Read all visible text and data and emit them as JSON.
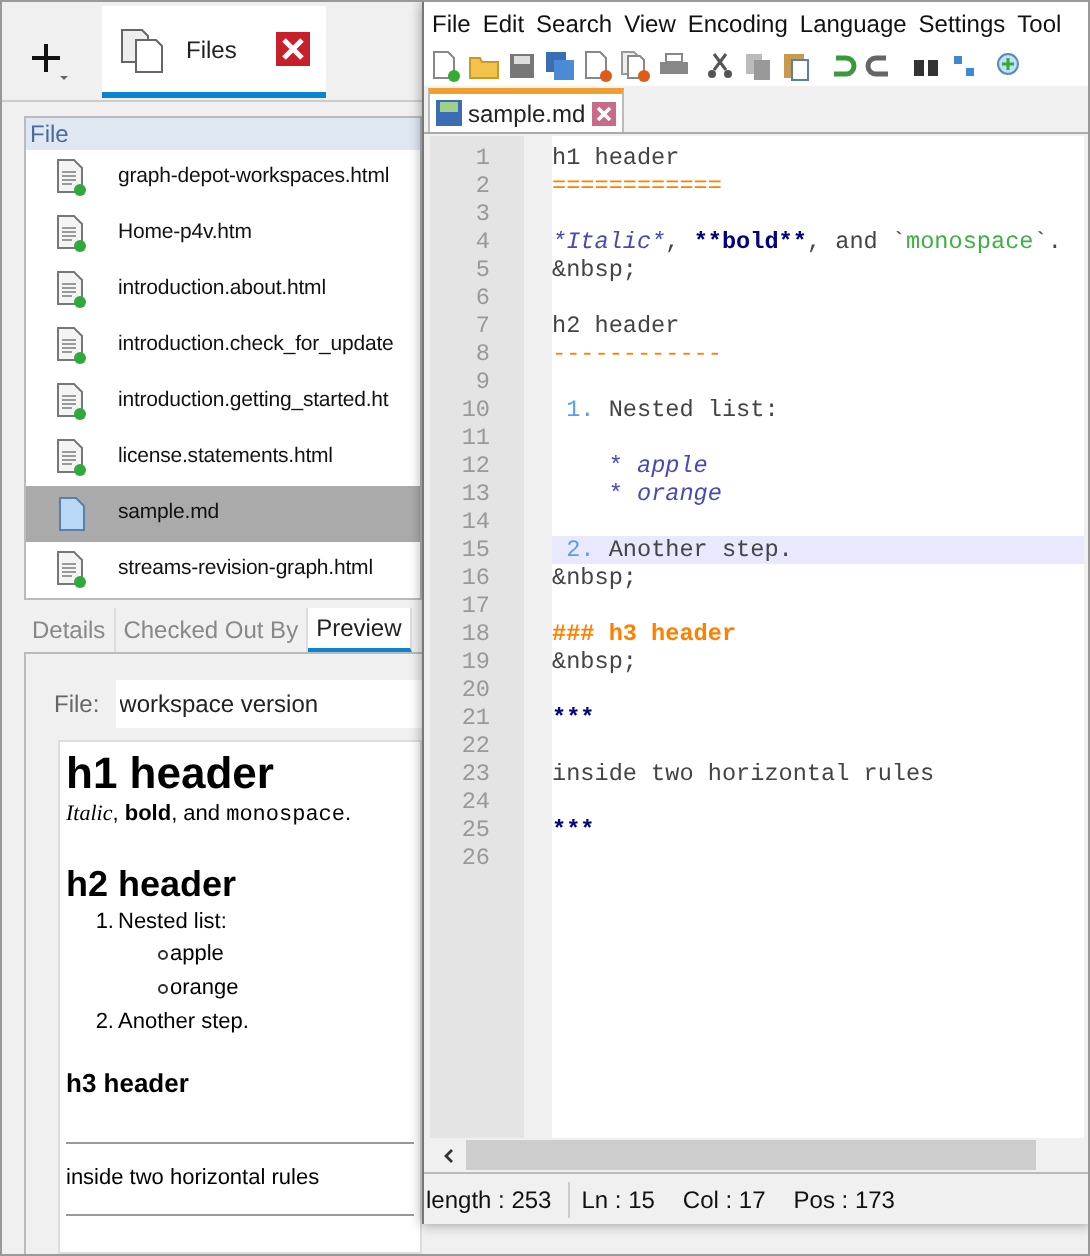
{
  "workspace_panel": {
    "tab": {
      "label": "Files",
      "selected": true
    },
    "file_list": {
      "column": "File",
      "rows": [
        {
          "name": "graph-depot-workspaces.html",
          "kind": "html",
          "selected": false
        },
        {
          "name": "Home-p4v.htm",
          "kind": "html",
          "selected": false
        },
        {
          "name": "introduction.about.html",
          "kind": "html",
          "selected": false
        },
        {
          "name": "introduction.check_for_update",
          "kind": "html",
          "selected": false
        },
        {
          "name": "introduction.getting_started.ht",
          "kind": "html",
          "selected": false
        },
        {
          "name": "license.statements.html",
          "kind": "html",
          "selected": false
        },
        {
          "name": "sample.md",
          "kind": "md",
          "selected": true
        },
        {
          "name": "streams-revision-graph.html",
          "kind": "html",
          "selected": false
        }
      ]
    },
    "detail_tabs": [
      {
        "label": "Details",
        "selected": false
      },
      {
        "label": "Checked Out By",
        "selected": false
      },
      {
        "label": "Preview",
        "selected": true
      }
    ],
    "file_field": {
      "label": "File:",
      "value": "workspace version"
    },
    "preview": [
      {
        "kind": "h1",
        "text": "h1 header"
      },
      {
        "kind": "para",
        "segments": [
          {
            "kind": "italic",
            "text": "Italic"
          },
          {
            "kind": "plain",
            "text": ", "
          },
          {
            "kind": "bold",
            "text": "bold"
          },
          {
            "kind": "plain",
            "text": ", and "
          },
          {
            "kind": "code",
            "text": "monospace"
          },
          {
            "kind": "plain",
            "text": "."
          }
        ]
      },
      {
        "kind": "h2",
        "text": "h2 header"
      },
      {
        "kind": "ol",
        "number": "1.",
        "text": "Nested list:",
        "children": [
          {
            "text": "apple"
          },
          {
            "text": "orange"
          }
        ]
      },
      {
        "kind": "ol",
        "number": "2.",
        "text": "Another step."
      },
      {
        "kind": "h3",
        "text": "h3 header"
      },
      {
        "kind": "hr"
      },
      {
        "kind": "text",
        "text": "inside two horizontal rules"
      },
      {
        "kind": "hr"
      }
    ]
  },
  "editor": {
    "menu": [
      "File",
      "Edit",
      "Search",
      "View",
      "Encoding",
      "Language",
      "Settings",
      "Tool"
    ],
    "tab": {
      "label": "sample.md",
      "selected": true
    },
    "lines": [
      {
        "number": "1",
        "current": false,
        "segments": [
          {
            "kind": "plain",
            "text": "h1 header"
          }
        ]
      },
      {
        "number": "2",
        "current": false,
        "segments": [
          {
            "kind": "heading",
            "text": "============"
          }
        ]
      },
      {
        "number": "3",
        "current": false
      },
      {
        "number": "4",
        "current": false,
        "segments": [
          {
            "kind": "italic",
            "text": "*Italic*"
          },
          {
            "kind": "plain",
            "text": ", "
          },
          {
            "kind": "bold",
            "text": "**bold**"
          },
          {
            "kind": "plain",
            "text": ", and `"
          },
          {
            "kind": "code",
            "text": "monospace"
          },
          {
            "kind": "plain",
            "text": "`."
          }
        ]
      },
      {
        "number": "5",
        "current": false,
        "segments": [
          {
            "kind": "plain",
            "text": "&nbsp;"
          }
        ]
      },
      {
        "number": "6",
        "current": false
      },
      {
        "number": "7",
        "current": false,
        "segments": [
          {
            "kind": "plain",
            "text": "h2 header"
          }
        ]
      },
      {
        "number": "8",
        "current": false,
        "segments": [
          {
            "kind": "heading",
            "text": "------------"
          }
        ]
      },
      {
        "number": "9",
        "current": false
      },
      {
        "number": "10",
        "current": false,
        "segments": [
          {
            "kind": "number",
            "text": " 1. "
          },
          {
            "kind": "plain",
            "text": "Nested list:"
          }
        ]
      },
      {
        "number": "11",
        "current": false
      },
      {
        "number": "12",
        "current": false,
        "segments": [
          {
            "kind": "bullet",
            "text": "    * "
          },
          {
            "kind": "italic",
            "text": "apple"
          }
        ]
      },
      {
        "number": "13",
        "current": false,
        "segments": [
          {
            "kind": "bullet",
            "text": "    * "
          },
          {
            "kind": "italic",
            "text": "orange"
          }
        ]
      },
      {
        "number": "14",
        "current": false
      },
      {
        "number": "15",
        "current": true,
        "segments": [
          {
            "kind": "number",
            "text": " 2. "
          },
          {
            "kind": "plain",
            "text": "Another step."
          }
        ]
      },
      {
        "number": "16",
        "current": false,
        "segments": [
          {
            "kind": "plain",
            "text": "&nbsp;"
          }
        ]
      },
      {
        "number": "17",
        "current": false
      },
      {
        "number": "18",
        "current": false,
        "segments": [
          {
            "kind": "h3",
            "text": "### h3 header"
          }
        ]
      },
      {
        "number": "19",
        "current": false,
        "segments": [
          {
            "kind": "plain",
            "text": "&nbsp;"
          }
        ]
      },
      {
        "number": "20",
        "current": false
      },
      {
        "number": "21",
        "current": false,
        "segments": [
          {
            "kind": "bold",
            "text": "***"
          }
        ]
      },
      {
        "number": "22",
        "current": false
      },
      {
        "number": "23",
        "current": false,
        "segments": [
          {
            "kind": "plain",
            "text": "inside two horizontal rules"
          }
        ]
      },
      {
        "number": "24",
        "current": false
      },
      {
        "number": "25",
        "current": false,
        "segments": [
          {
            "kind": "bold",
            "text": "***"
          }
        ]
      },
      {
        "number": "26",
        "current": false
      }
    ],
    "status_bar": [
      "length : 253",
      "Ln : 15",
      "Col : 17",
      "Pos : 173"
    ]
  }
}
